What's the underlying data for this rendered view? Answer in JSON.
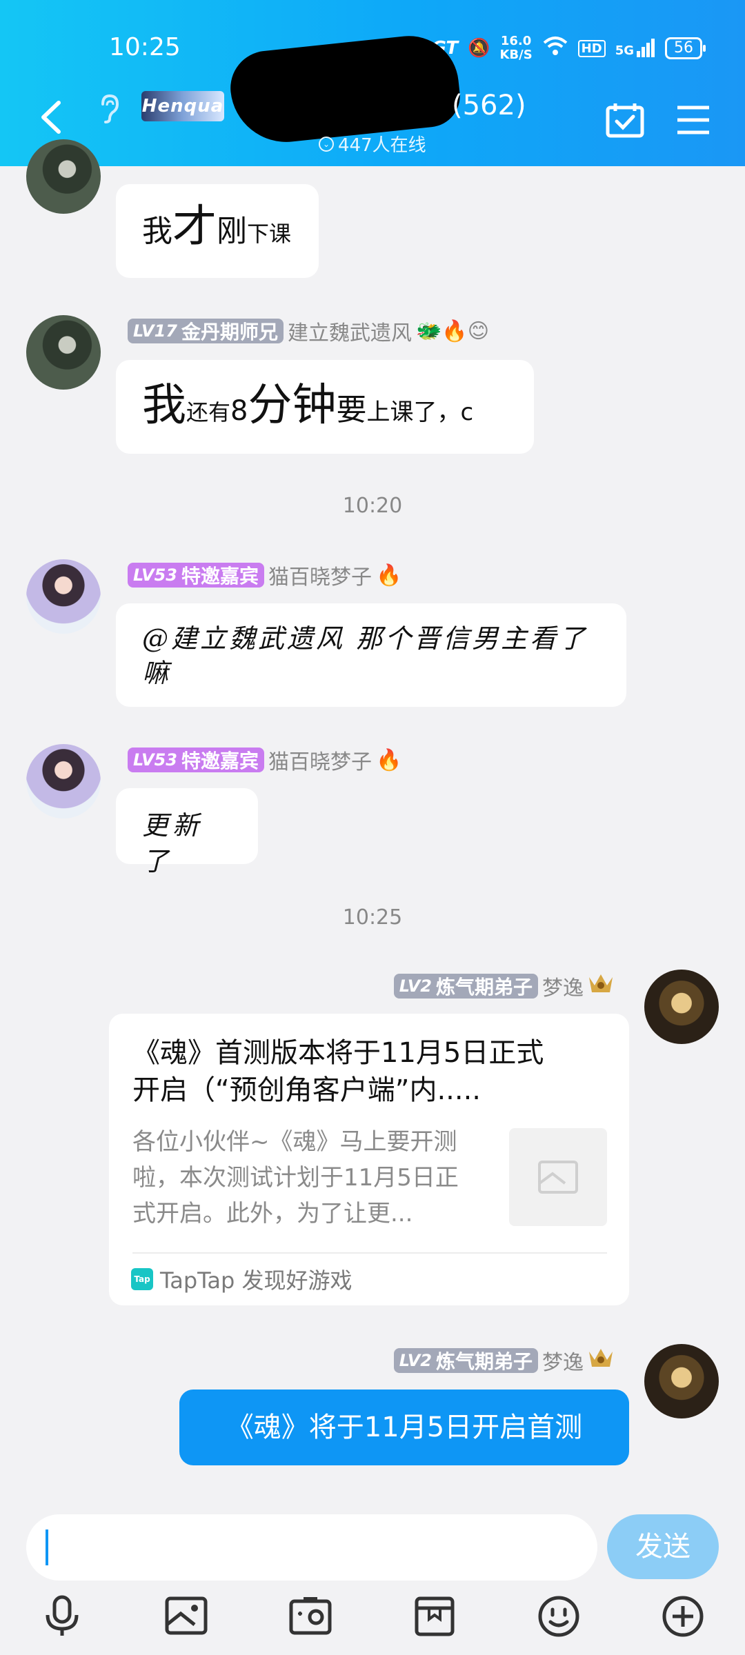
{
  "status_bar": {
    "time": "10:25",
    "net_speed_top": "16.0",
    "net_speed_bottom": "KB/S",
    "hd": "HD",
    "signal": "5G",
    "battery": "56"
  },
  "header": {
    "group_logo_text": "Henqua",
    "member_count": "(562)",
    "online": "447人在线"
  },
  "messages": [
    {
      "id": "m1",
      "segments": [
        {
          "t": "我",
          "s": 44
        },
        {
          "t": "才",
          "s": 64
        },
        {
          "t": "刚",
          "s": 44
        },
        {
          "t": "下课",
          "s": 32
        }
      ]
    },
    {
      "id": "m2",
      "level": "LV17",
      "title": "金丹期师兄",
      "nickname": "建立魏武遗风",
      "badges": "🐲🔥😊",
      "segments": [
        {
          "t": "我",
          "s": 64
        },
        {
          "t": "还有",
          "s": 32
        },
        {
          "t": "8",
          "s": 40
        },
        {
          "t": "分钟",
          "s": 64
        },
        {
          "t": "要",
          "s": 44
        },
        {
          "t": "上课了，",
          "s": 34
        },
        {
          "t": "c",
          "s": 34
        }
      ]
    },
    {
      "id": "sep1",
      "time": "10:20"
    },
    {
      "id": "m3",
      "level": "LV53",
      "title": "特邀嘉宾",
      "nickname": "猫百晓梦子",
      "badges": "🔥",
      "text": "@建立魏武遗风 那个晋信男主看了嘛"
    },
    {
      "id": "m4",
      "level": "LV53",
      "title": "特邀嘉宾",
      "nickname": "猫百晓梦子",
      "badges": "🔥",
      "text": "更新了"
    },
    {
      "id": "sep2",
      "time": "10:25"
    },
    {
      "id": "m5",
      "level": "LV2",
      "title": "炼气期弟子",
      "nickname": "梦逸",
      "card_title_1": "《魂》首测版本将于11月5日正式",
      "card_title_2": "开启（“预创角客户端”内.....",
      "card_desc_1": "各位小伙伴~《魂》马上要开测",
      "card_desc_2": "啦，本次测试计划于11月5日正",
      "card_desc_3": "式开启。此外，为了让更...",
      "card_source": "TapTap 发现好游戏",
      "tap_logo": "Tap"
    },
    {
      "id": "m6",
      "level": "LV2",
      "title": "炼气期弟子",
      "nickname": "梦逸",
      "text": "《魂》将于11月5日开启首测"
    }
  ],
  "composer": {
    "send_label": "发送"
  },
  "icons": [
    "back-icon",
    "ear-icon",
    "calendar-check-icon",
    "menu-icon",
    "microphone-icon",
    "image-icon",
    "camera-icon",
    "gift-box-icon",
    "emoji-icon",
    "plus-icon"
  ]
}
